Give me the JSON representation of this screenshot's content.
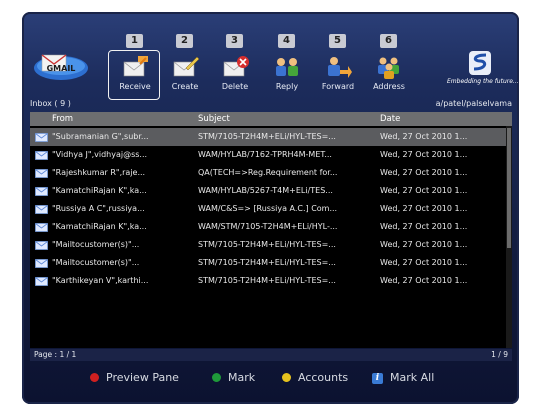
{
  "app": {
    "logo_text": "GMAIL"
  },
  "toolbar": {
    "items": [
      {
        "num": "1",
        "label": "Receive",
        "icon": "receive-mail-icon",
        "selected": true
      },
      {
        "num": "2",
        "label": "Create",
        "icon": "create-mail-icon",
        "selected": false
      },
      {
        "num": "3",
        "label": "Delete",
        "icon": "delete-mail-icon",
        "selected": false
      },
      {
        "num": "4",
        "label": "Reply",
        "icon": "reply-icon",
        "selected": false
      },
      {
        "num": "5",
        "label": "Forward",
        "icon": "forward-icon",
        "selected": false
      },
      {
        "num": "6",
        "label": "Address",
        "icon": "address-book-icon",
        "selected": false
      }
    ]
  },
  "brand": {
    "tagline": "Embedding the future..."
  },
  "inbox": {
    "title": "Inbox ( 9 )",
    "user": "a/patel/palselvama",
    "columns": {
      "from": "From",
      "subject": "Subject",
      "date": "Date"
    },
    "rows": [
      {
        "from": "\"Subramanian G\",subr...",
        "subject": "STM/7105-T2H4M+ELi/HYL-TES=...",
        "date": "Wed, 27 Oct 2010 1...",
        "selected": true
      },
      {
        "from": "\"Vidhya J\",vidhyaj@ss...",
        "subject": "WAM/HYLAB/7162-TPRH4M-MET...",
        "date": "Wed, 27 Oct 2010 1...",
        "selected": false
      },
      {
        "from": "\"Rajeshkumar R\",raje...",
        "subject": "QA(TECH=>Reg.Requirement for...",
        "date": "Wed, 27 Oct 2010 1...",
        "selected": false
      },
      {
        "from": "\"KamatchiRajan K\",ka...",
        "subject": "WAM/HYLAB/5267-T4M+ELi/TES...",
        "date": "Wed, 27 Oct 2010 1...",
        "selected": false
      },
      {
        "from": "\"Russiya A C\",russiya...",
        "subject": "WAM/C&S=> [Russiya A.C.] Com...",
        "date": "Wed, 27 Oct 2010 1...",
        "selected": false
      },
      {
        "from": "\"KamatchiRajan K\",ka...",
        "subject": "WAM/STM/7105-T2H4M+ELi/HYL-...",
        "date": "Wed, 27 Oct 2010 1...",
        "selected": false
      },
      {
        "from": "\"Mailtocustomer(s)\"...",
        "subject": "STM/7105-T2H4M+ELi/HYL-TES=...",
        "date": "Wed, 27 Oct 2010 1...",
        "selected": false
      },
      {
        "from": "\"Mailtocustomer(s)\"...",
        "subject": "STM/7105-T2H4M+ELi/HYL-TES=...",
        "date": "Wed, 27 Oct 2010 1...",
        "selected": false
      },
      {
        "from": "\"Karthikeyan V\",karthi...",
        "subject": "STM/7105-T2H4M+ELi/HYL-TES=...",
        "date": "Wed, 27 Oct 2010 1...",
        "selected": false
      }
    ]
  },
  "pager": {
    "left": "Page : 1 / 1",
    "right": "1 / 9"
  },
  "legend": [
    {
      "key": "red",
      "color": "#d02020",
      "label": "Preview Pane"
    },
    {
      "key": "green",
      "color": "#1f9a3a",
      "label": "Mark"
    },
    {
      "key": "yellow",
      "color": "#e6c21e",
      "label": "Accounts"
    },
    {
      "key": "info",
      "color": "#3a7bd5",
      "label": "Mark All"
    }
  ]
}
